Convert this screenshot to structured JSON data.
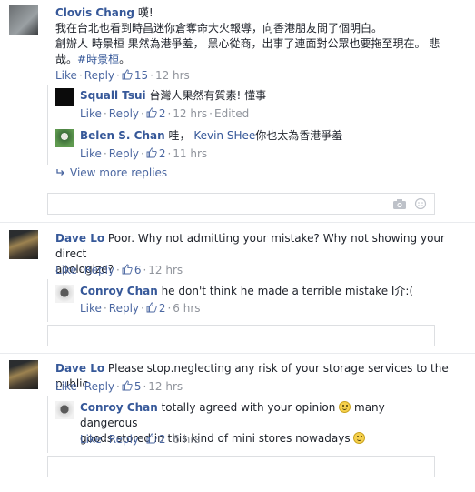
{
  "comments": [
    {
      "author": "Clovis Chang",
      "text_lines": [
        "嘆!",
        "我在台北也看到時昌迷你倉奪命大火報導，向香港朋友問了個明白。",
        "創辦人 時景桓 果然為港爭羞， 黑心從商，出事了連面對公眾也要拖至現在。 悲",
        "哉。"
      ],
      "hashtag": "#時景桓",
      "tail": "。",
      "like": "Like",
      "reply": "Reply",
      "likes": "15",
      "time": "12 hrs",
      "replies": [
        {
          "author": "Squall Tsui",
          "text": "台灣人果然有質素! 懂事",
          "like": "Like",
          "reply": "Reply",
          "likes": "2",
          "time": "12 hrs",
          "edited": "Edited"
        },
        {
          "author": "Belen S. Chan",
          "text_pre": "哇，",
          "mention": "Kevin SHee",
          "text_post": "你也太為香港爭羞",
          "like": "Like",
          "reply": "Reply",
          "likes": "2",
          "time": "11 hrs"
        }
      ],
      "view_more": "View more replies"
    },
    {
      "author": "Dave Lo",
      "text_line1": "Poor. Why not admitting your mistake? Why not showing your direct",
      "text_line2": "apologize?",
      "like": "Like",
      "reply": "Reply",
      "likes": "6",
      "time": "12 hrs",
      "reply1": {
        "author": "Conroy Chan",
        "text": "he don't think he made a terrible mistake I介:(",
        "like": "Like",
        "reply": "Reply",
        "likes": "2",
        "time": "6 hrs"
      }
    },
    {
      "author": "Dave Lo",
      "text": "Please stop.neglecting any risk of your storage services to the public",
      "like": "Like",
      "reply": "Reply",
      "likes": "5",
      "time": "12 hrs",
      "reply1": {
        "author": "Conroy Chan",
        "text_line1": "totally agreed with your opinion",
        "text_mid": "many dangerous",
        "text_line2": "goods stored in this kind of mini stores nowadays",
        "like": "Like",
        "reply": "Reply",
        "likes": "2",
        "time": "6 hrs"
      }
    }
  ],
  "colors": {
    "name": "#365899",
    "meta": "#90949c",
    "action": "#4b67a1"
  },
  "icons": [
    "thumbs-up-icon",
    "reply-arrow-icon",
    "camera-icon",
    "smile-emoji-icon"
  ]
}
